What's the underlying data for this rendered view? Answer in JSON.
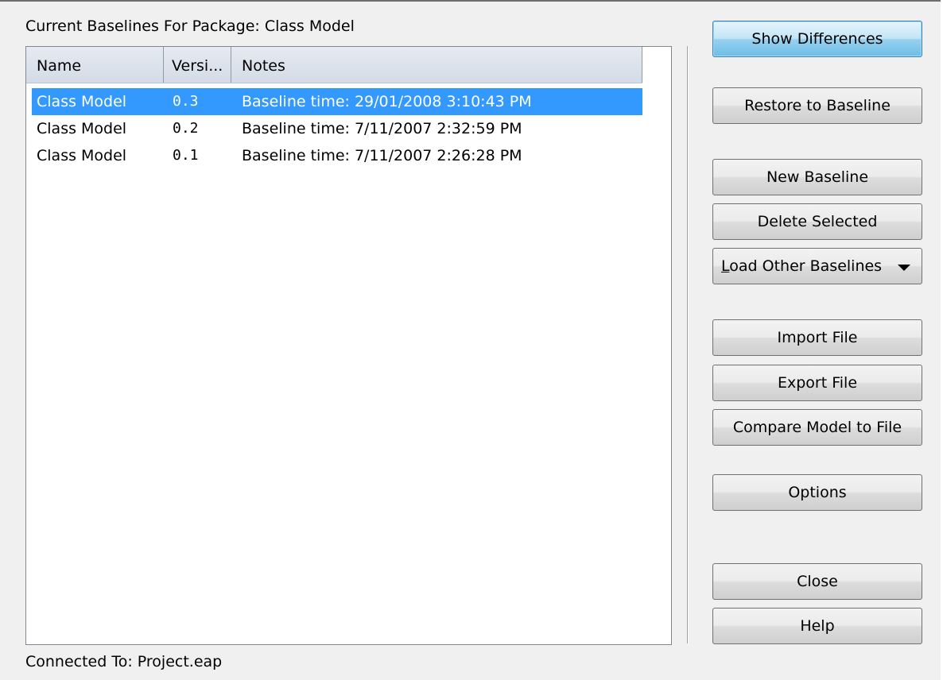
{
  "header": {
    "label": "Current Baselines For Package: Class Model"
  },
  "list": {
    "columns": {
      "name": "Name",
      "version": "Versi...",
      "notes": "Notes"
    },
    "rows": [
      {
        "name": "Class Model",
        "version": "0.3",
        "notes": "Baseline time: 29/01/2008 3:10:43 PM",
        "selected": true
      },
      {
        "name": "Class Model",
        "version": "0.2",
        "notes": "Baseline time: 7/11/2007 2:32:59 PM",
        "selected": false
      },
      {
        "name": "Class Model",
        "version": "0.1",
        "notes": "Baseline time: 7/11/2007 2:26:28 PM",
        "selected": false
      }
    ]
  },
  "buttons": {
    "show_differences": "Show Differences",
    "restore_to_baseline": "Restore to Baseline",
    "new_baseline": "New Baseline",
    "delete_selected": "Delete Selected",
    "load_other_baselines_hotkey": "L",
    "load_other_baselines_rest": "oad Other Baselines",
    "load_other_baselines_icon": "dropdown-arrow-icon",
    "import_file": "Import File",
    "export_file": "Export File",
    "compare_model_to_file": "Compare Model to File",
    "options": "Options",
    "close": "Close",
    "help": "Help"
  },
  "footer": {
    "connected_to": "Connected To: Project.eap"
  },
  "colors": {
    "dialog_bg": "#f0f0f0",
    "selection_bg": "#3399ff",
    "selection_text": "#ffffff",
    "default_button": "#98d1ef"
  }
}
